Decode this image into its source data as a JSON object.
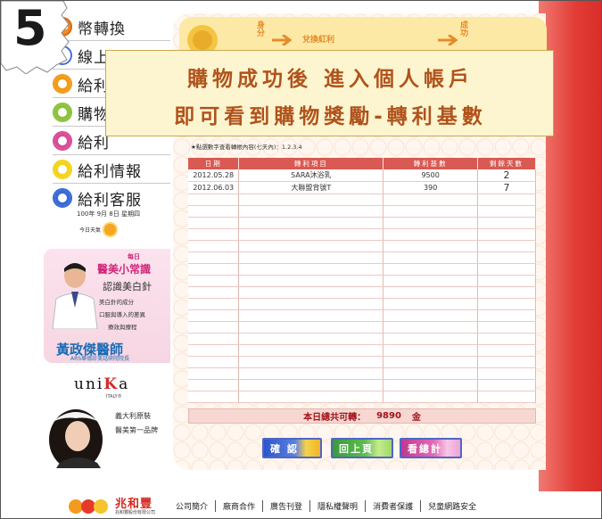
{
  "step_number": "5",
  "menu": [
    {
      "label": "幣轉換",
      "color": "#f28a2c",
      "badge": "CO"
    },
    {
      "label": "線上",
      "color": "#4b6fd1"
    },
    {
      "label": "給利",
      "color": "#f29b18"
    },
    {
      "label": "購物",
      "color": "#8bc33a"
    },
    {
      "label": "給利",
      "color": "#d94c98"
    },
    {
      "label": "給利情報",
      "color": "#f5d31e"
    },
    {
      "label": "給利客服",
      "color": "#3a6ad6"
    }
  ],
  "date": "100年 9月 8日 星期四",
  "weather_label": "今日天氣",
  "hero": {
    "left_word": "身分",
    "mid_word": "兌換紅利",
    "right_word": "成功"
  },
  "banner": {
    "line1": "購物成功後 進入個人帳戶",
    "line2": "即可看到購物獎勵-轉利基數"
  },
  "note": "★點選數字查看轉帳內容(七天內)：1.2.3.4",
  "table": {
    "headers": [
      "日期",
      "轉利項目",
      "轉利基數",
      "剩餘天數"
    ],
    "rows": [
      [
        "2012.05.28",
        "SARA沐浴乳",
        "9500",
        "2"
      ],
      [
        "2012.06.03",
        "大聯盟背號T",
        "390",
        "7"
      ],
      [
        "",
        "",
        "",
        ""
      ],
      [
        "",
        "",
        "",
        ""
      ],
      [
        "",
        "",
        "",
        ""
      ],
      [
        "",
        "",
        "",
        ""
      ],
      [
        "",
        "",
        "",
        ""
      ],
      [
        "",
        "",
        "",
        ""
      ],
      [
        "",
        "",
        "",
        ""
      ],
      [
        "",
        "",
        "",
        ""
      ],
      [
        "",
        "",
        "",
        ""
      ],
      [
        "",
        "",
        "",
        ""
      ],
      [
        "",
        "",
        "",
        ""
      ],
      [
        "",
        "",
        "",
        ""
      ],
      [
        "",
        "",
        "",
        ""
      ],
      [
        "",
        "",
        "",
        ""
      ],
      [
        "",
        "",
        "",
        ""
      ],
      [
        "",
        "",
        "",
        ""
      ],
      [
        "",
        "",
        "",
        ""
      ],
      [
        "",
        "",
        "",
        ""
      ]
    ]
  },
  "total": {
    "label": "本日總共可轉：",
    "value": "9890",
    "unit": "金"
  },
  "buttons": {
    "confirm": "確 認",
    "back": "回上頁",
    "print": "看總計"
  },
  "ad_beauty": {
    "day": "每日",
    "title": "醫美小常識",
    "subtitle": "認識美白針",
    "lines": [
      "美白針的成分",
      "口服與導入的差異",
      "療效與療程"
    ],
    "doctor": "黃政傑醫師",
    "footer": "ARS華德診美話研院院長"
  },
  "ad_unika": {
    "logo_pre": "uni",
    "logo_k": "K",
    "logo_post": "a",
    "italy": "ITALY®",
    "line1": "義大利原裝",
    "line2": "醫美第一品牌"
  },
  "footer": {
    "brand": "兆和豐",
    "brand_sub": "兆和豐股份有限公司",
    "links": [
      "公司簡介",
      "廠商合作",
      "廣告刊登",
      "隱私權聲明",
      "消費者保護",
      "兒童網路安全"
    ]
  },
  "colors": {
    "accent_red": "#d85a52",
    "banner_text": "#b0531c",
    "brand_red": "#d7261c"
  }
}
